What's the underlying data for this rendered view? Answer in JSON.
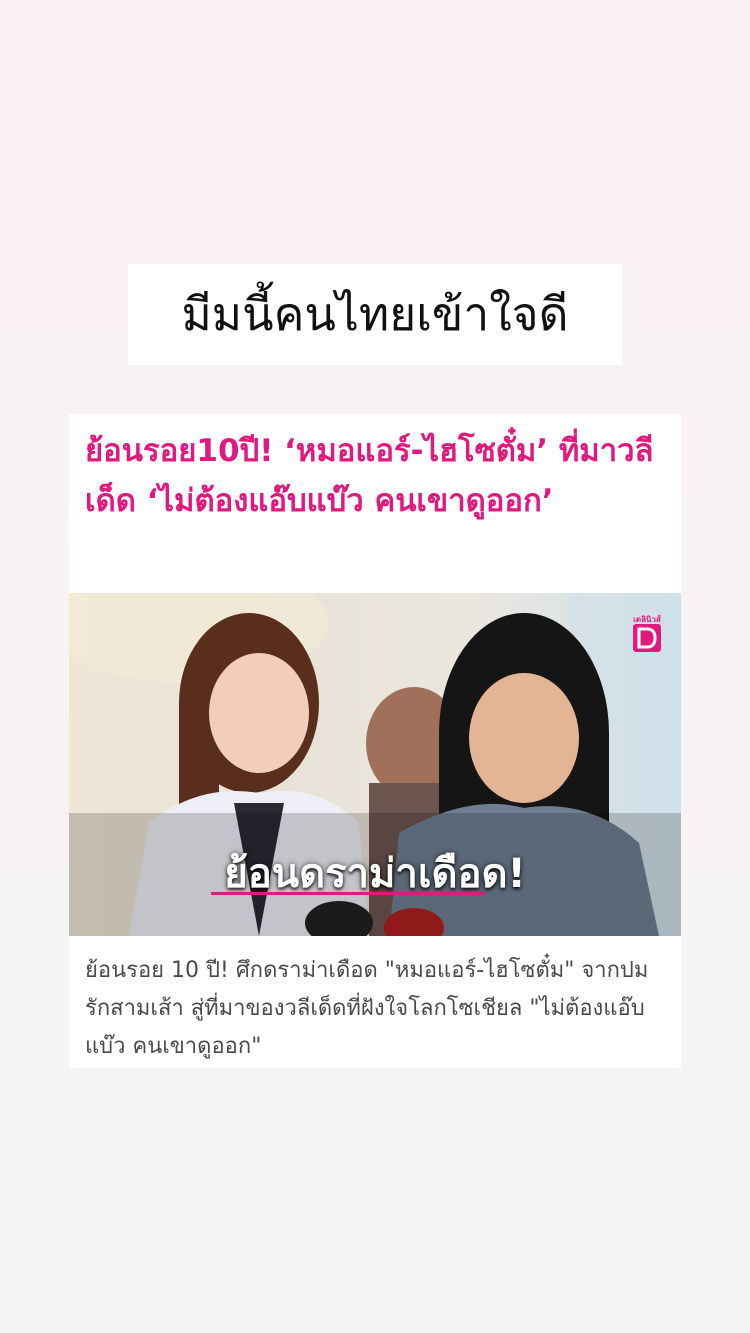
{
  "headline": "มีมนี้คนไทยเข้าใจดี",
  "card": {
    "title": "ย้อนรอย10ปี! ‘หมอแอร์-ไฮโซตั๋ม’ ที่มาวลีเด็ด ‘ไม่ต้องแอ๊บแบ๊ว คนเขาดูออก’",
    "image_caption": "ย้อนดราม่าเดือด!",
    "brand_logo_text": "เดลินิวส์",
    "description": "ย้อนรอย 10 ปี! ศึกดราม่าเดือด \"หมอแอร์-ไฮโซตั๋ม\" จากปมรักสามเส้า สู่ที่มาของวลีเด็ดที่ฝังใจโลกโซเชียล \"ไม่ต้องแอ๊บแบ๊ว คนเขาดูออก\""
  },
  "colors": {
    "accent": "#e0197e",
    "title_text": "#111111",
    "description_text": "#4a4a4a"
  }
}
